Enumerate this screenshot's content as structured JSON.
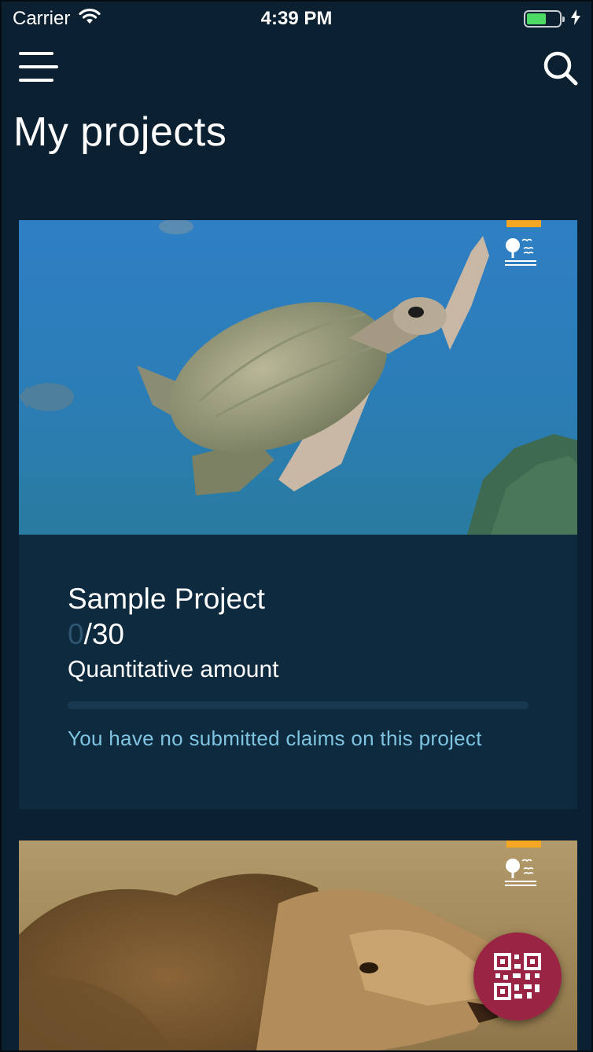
{
  "status_bar": {
    "carrier": "Carrier",
    "time": "4:39 PM",
    "battery_level": 0.6
  },
  "header": {
    "menu_icon": "hamburger-menu-icon",
    "search_icon": "search-icon",
    "title": "My projects"
  },
  "projects": [
    {
      "image": "sea-turtle-photo",
      "type_icon": "environment-type-icon",
      "name": "Sample Project",
      "progress": {
        "done": "0",
        "total": "/30",
        "fraction": 0
      },
      "label": "Quantitative amount",
      "claims_note": "You have no submitted claims on this project"
    },
    {
      "image": "lion-photo",
      "type_icon": "environment-type-icon"
    }
  ],
  "fab": {
    "icon": "qr-code-icon"
  },
  "colors": {
    "background": "#0b2030",
    "card": "#0e2a3f",
    "accent_badge": "#f5a623",
    "fab": "#9a2443",
    "note_text": "#7fc4e0"
  }
}
